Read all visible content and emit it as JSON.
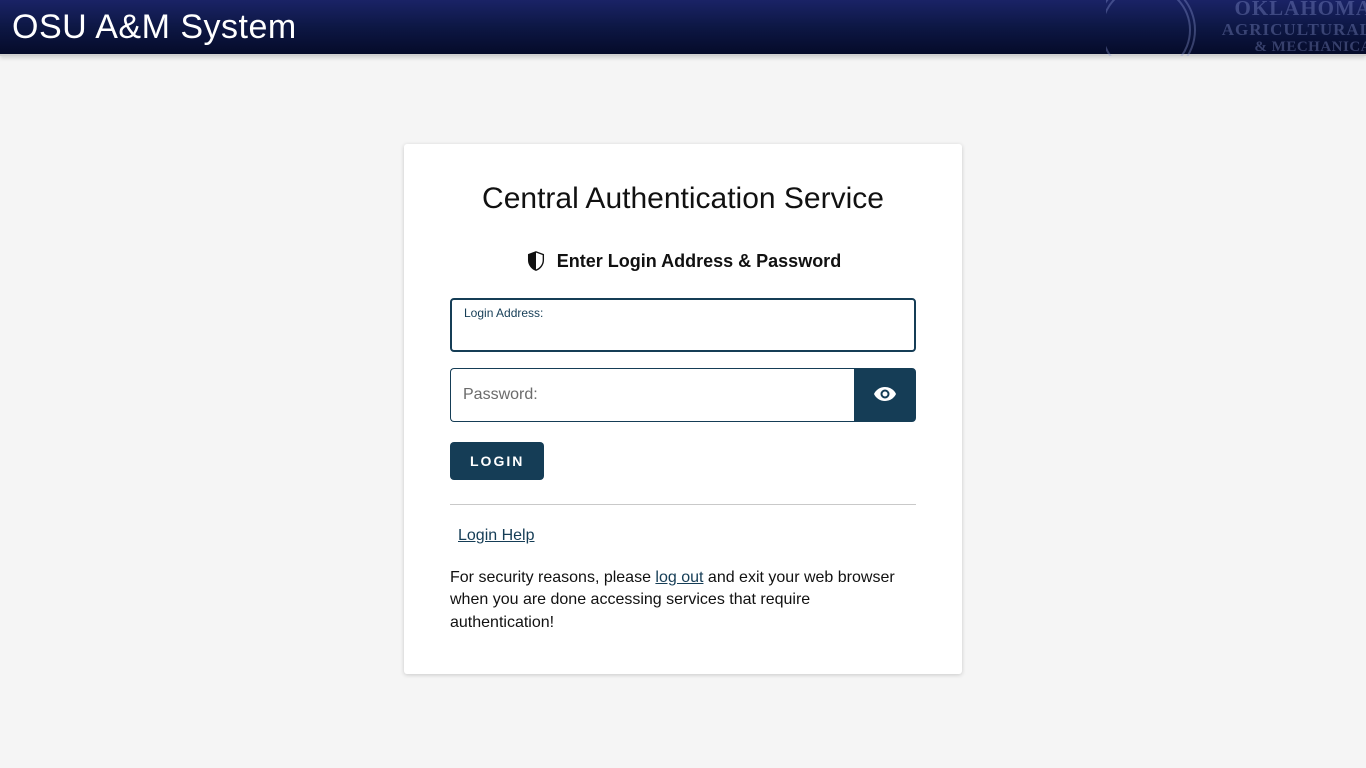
{
  "header": {
    "title": "OSU A&M System",
    "seal_line1": "OKLAHOMA",
    "seal_line2": "AGRICULTURAL",
    "seal_line3": "& MECHANICA"
  },
  "card": {
    "title": "Central Authentication Service",
    "prompt": "Enter Login Address & Password"
  },
  "form": {
    "login_label": "Login Address:",
    "login_value": "",
    "password_placeholder": "Password:",
    "password_value": "",
    "login_button": "LOGIN"
  },
  "links": {
    "help": "Login Help",
    "logout": "log out"
  },
  "security": {
    "before": "For security reasons, please ",
    "after": " and exit your web browser when you are done accessing services that require authentication!"
  },
  "colors": {
    "accent": "#153d56",
    "header_gradient_top": "#1a2366",
    "header_gradient_bottom": "#050b2a"
  }
}
